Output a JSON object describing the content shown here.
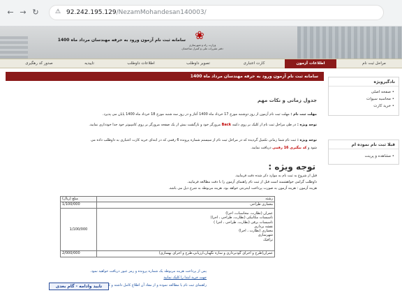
{
  "browser": {
    "back_icon": "arrow-left-icon",
    "forward_icon": "arrow-right-icon",
    "reload_icon": "reload-icon",
    "security_icon": "not-secure-icon",
    "url_host": "92.242.195.129",
    "url_path": "/NezamMohandesan140003/"
  },
  "banner": {
    "headline": "سامانه ثبت نام آزمون ورود به حرفه مهندسان مرداد ماه 1400",
    "org_line1": "وزارت راه و شهرسازی",
    "org_line2": "دفتر مقررات ملی و کنترل ساختمان",
    "emblem_icon": "iran-emblem-icon"
  },
  "tabs": [
    "مراحل ثبت نام",
    "اطلاعات آزمون",
    "کارت اعتباری",
    "تصویر داوطلب",
    "اطلاعات داوطلب",
    "تاییدیه",
    "صدور کد رهگیری"
  ],
  "main": {
    "header": "سامانه ثبت نام آزمون ورود به حرفه مهندسان مرداد ماه 1400",
    "section_title": "جدول زمانی و نکات مهم",
    "line1_label": "مهلت ثبت نام :",
    "line1_text": "مهلت ثبت نام آزمون از روز دوشنبه مورخ 17 خرداد ماه 1400 آغاز و در روز سه شنبه مورخ 18 خرداد ماه 1400 پایان می پذیرد.",
    "line2_label": "توجه ویژه :",
    "line2_pre": "در طی مراحل ثبت نام از کلیک بر روی دکمه",
    "line2_back": "Back",
    "line2_post": "مرورگر خود و بازگشت بیش از یک صفحه مرورگر بر روی کامپیوتر خود جدا خودداری نمایید.",
    "line3_label": "توجه ویژه :",
    "line3_text": "ثبت نام شما زمانی تکمیل گردیده که در مراحل ثبت نام از سیستم شماره پرونده 6 رقمی که در ابتدای خرید کارت اعتباری به داوطلب داده می",
    "line4_pre": "شود و",
    "line4_code": "کد بیگیری 16 رقمی",
    "line4_post": "دریافت نمایید.",
    "attention_title": "توجه ویژه :",
    "att1": "قبل از شروع به ثبت نام به موارد ذکر شده دقت فرمایید.",
    "att2": "داوطلب گرامی خواهشمند است قبل از ثبت نام راهنمای آزمون را با دقت مطالعه فرمایید.",
    "att3": "هزینه آزمون : هزینه آزمون به صورت پرداخت اینترنتی خواهد بود. هزینه مربوطه به شرح ذیل می باشد.",
    "table": {
      "header_field": "رشته",
      "header_amount": "مبلغ (ریال)",
      "row1_field": "معماری طراحی",
      "row1_amount": "1/100/000",
      "row2_fields": [
        "عمران (نظارت، محاسبات، اجرا)",
        "تاسیسات مکانیکی (نظارت، طراحی ، اجرا)",
        "تاسیسات برقی (نظارت، طراحی ، اجرا )",
        "نقشه برداری",
        "معماری (نظارت ، اجرا)",
        "شهرسازی",
        "ترافیک"
      ],
      "row2_amount": "1/100/000",
      "row3_field": "عمران(طرح و اجرای گودبرداری و سازه نگهبان،ارزیابی،طرح و اجرای بهسازی)",
      "row3_amount": "2/000/000"
    },
    "foot1": "پس از پرداخت هزینه مربوطه یک شماره پرونده و رمز عبور دریافت خواهید نمود.",
    "foot2": "جهت خرید ابتدا را کلیک نمایید",
    "foot3": "راهنمای ثبت نام یا مطالعه نموده و از مفاد آن اطلاع کامل داشته و کلیه شرایط آن را می پذیرم",
    "next_button": "تایید وادامه - گام بعدی"
  },
  "sidebar": {
    "nav_title": "نادگیرویژه",
    "nav_items": [
      "صفحه اصلی",
      "محاسبه سیوات",
      "خرید کارت"
    ],
    "reg_title": "قبلا ثبت نام نموده ام",
    "reg_items": [
      "مشاهده و پرینت"
    ]
  },
  "colors": {
    "brand": "#8b1a1a",
    "code_red": "#c00000",
    "button_border": "#2b4e9b"
  }
}
